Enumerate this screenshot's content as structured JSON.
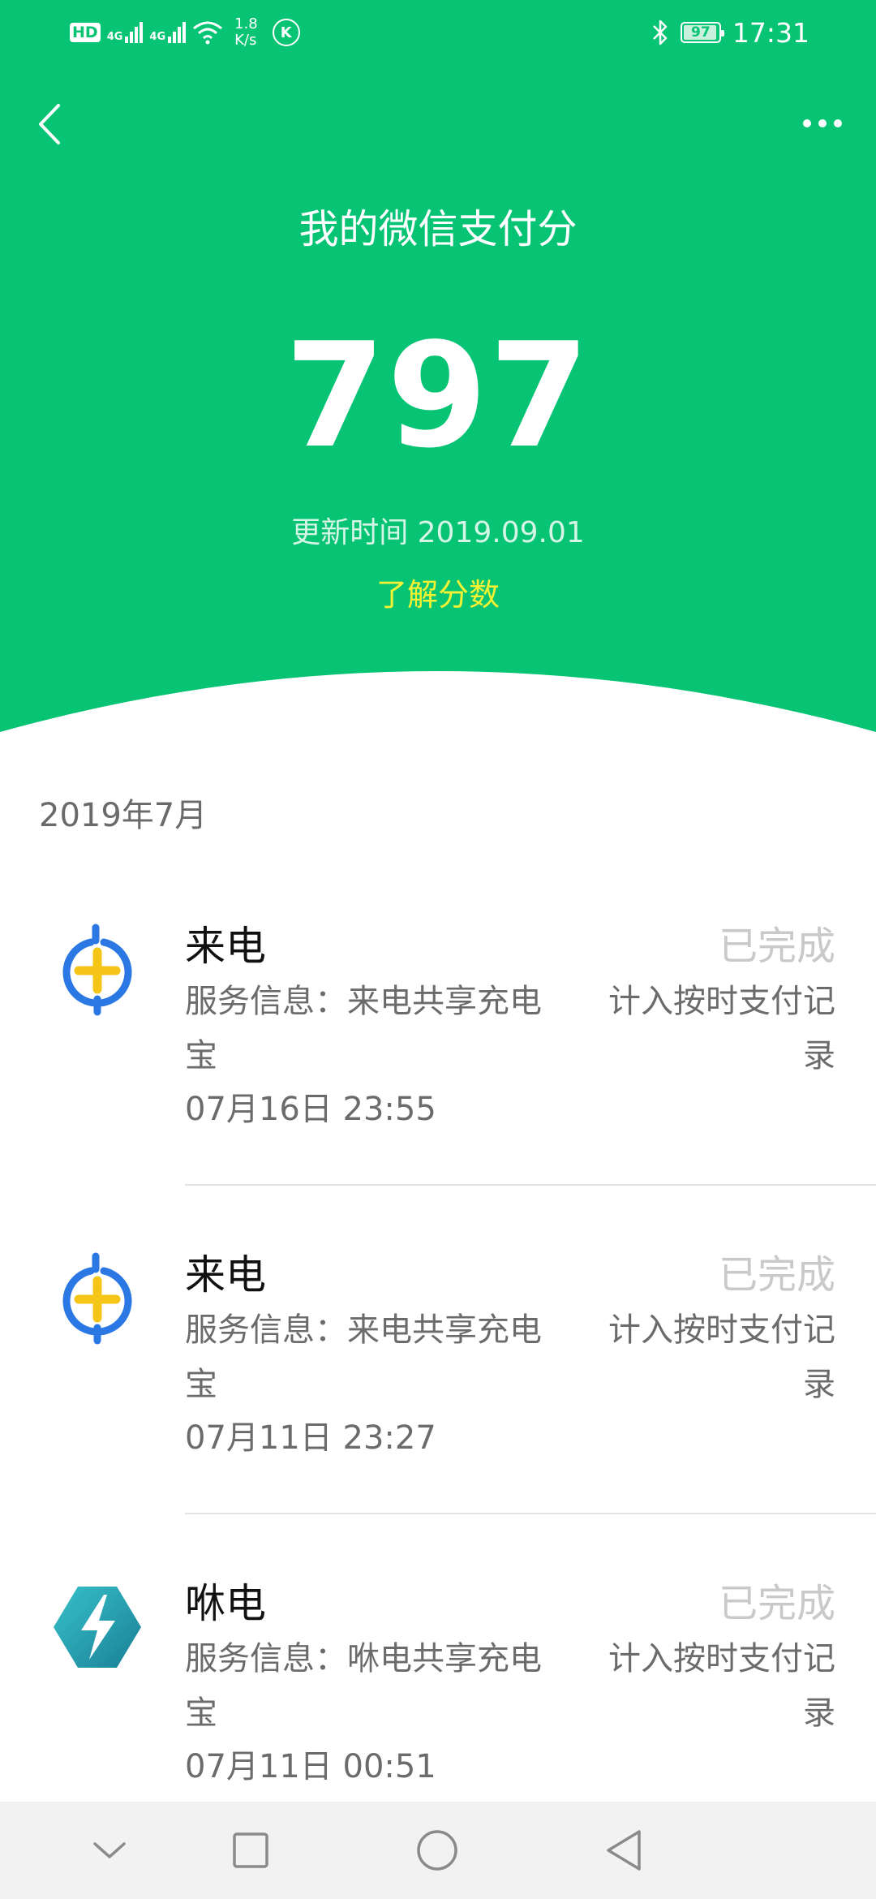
{
  "status_bar": {
    "hd": "HD",
    "sim1": "4G",
    "sim2": "4G",
    "speed_value": "1.8",
    "speed_unit": "K/s",
    "k_badge": "K",
    "bluetooth": "bluetooth-icon",
    "battery": "97",
    "time": "17:31"
  },
  "header": {
    "title": "我的微信支付分",
    "score": "797",
    "updated": "更新时间 2019.09.01",
    "learn_link": "了解分数",
    "colors": {
      "brand": "#07c474",
      "link": "#f5f233"
    }
  },
  "list": {
    "month": "2019年7月",
    "records": [
      {
        "icon": "laidian-plus-icon",
        "name": "来电",
        "status": "已完成",
        "info_line1": "服务信息：来电共享充电",
        "info_line2": "宝",
        "note_line1": "计入按时支付记",
        "note_line2": "录",
        "time": "07月16日 23:55"
      },
      {
        "icon": "laidian-plus-icon",
        "name": "来电",
        "status": "已完成",
        "info_line1": "服务信息：来电共享充电",
        "info_line2": "宝",
        "note_line1": "计入按时支付记",
        "note_line2": "录",
        "time": "07月11日 23:27"
      },
      {
        "icon": "lightning-icon",
        "name": "咻电",
        "status": "已完成",
        "info_line1": "服务信息：咻电共享充电",
        "info_line2": "宝",
        "note_line1": "计入按时支付记",
        "note_line2": "录",
        "time": "07月11日 00:51"
      }
    ]
  },
  "navbar": {
    "buttons": [
      "chevron-down-icon",
      "square-icon",
      "circle-home-icon",
      "triangle-back-icon"
    ]
  }
}
